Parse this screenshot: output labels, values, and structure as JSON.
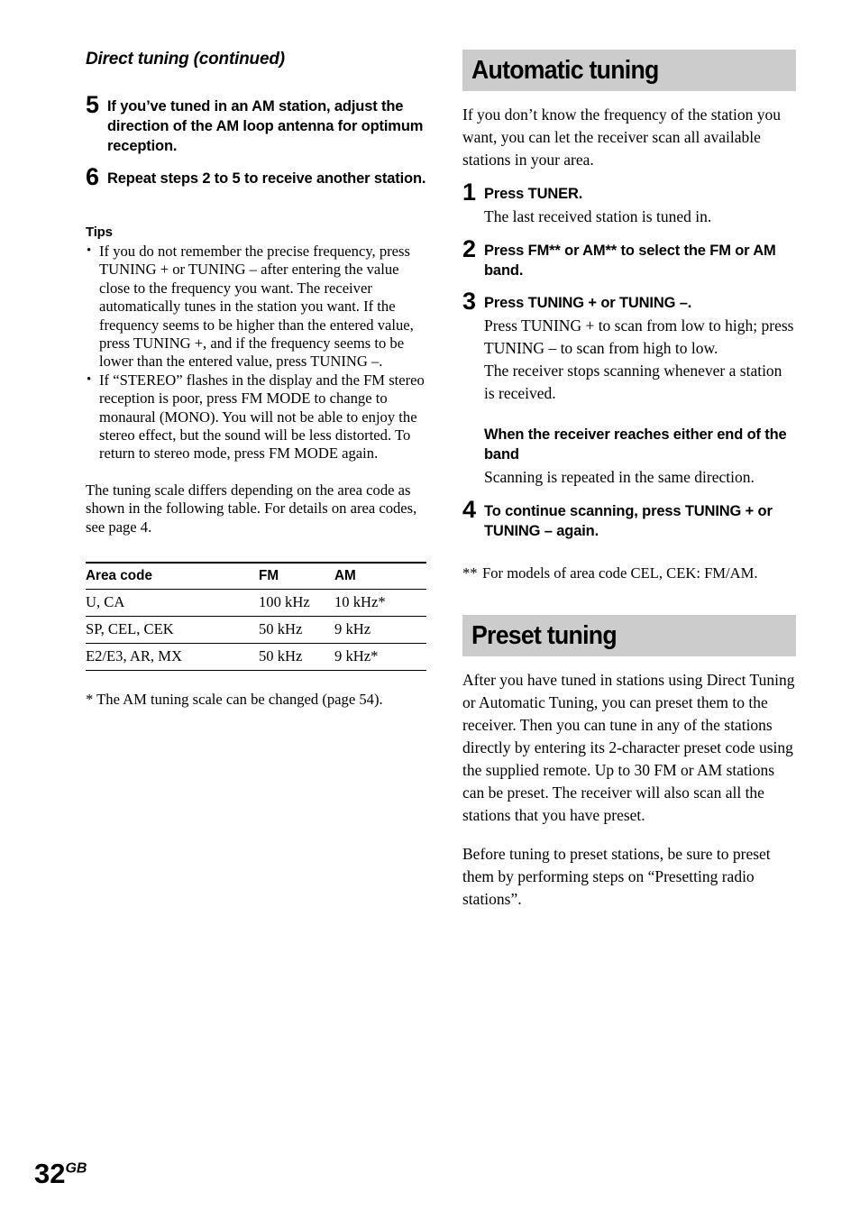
{
  "page": {
    "number": "32",
    "region_suffix": "GB"
  },
  "left_column": {
    "running_head": "Direct tuning (continued)",
    "steps": [
      {
        "number": "5",
        "title": "If you’ve tuned in an AM station, adjust the direction of the AM loop antenna for optimum reception."
      },
      {
        "number": "6",
        "title": "Repeat steps 2 to 5 to receive another station."
      }
    ],
    "tips_heading": "Tips",
    "tips": [
      "If you do not remember the precise frequency, press TUNING + or TUNING – after entering the value close to the frequency you want. The receiver automatically tunes in the station you want. If the frequency seems to be higher than the entered value, press TUNING +, and if the frequency seems to be lower than the entered value, press TUNING –.",
      "If “STEREO” flashes in the display and the FM stereo reception is poor, press FM MODE to change to monaural (MONO). You will not be able to enjoy the stereo effect, but the sound will be less distorted. To return to stereo mode, press FM MODE again."
    ],
    "table_intro": "The tuning scale differs depending on the area code as shown in the following table. For details on area codes, see page 4.",
    "table": {
      "headers": [
        "Area code",
        "FM",
        "AM"
      ],
      "rows": [
        [
          "U, CA",
          "100 kHz",
          "10 kHz*"
        ],
        [
          "SP, CEL, CEK",
          "50 kHz",
          "9 kHz"
        ],
        [
          "E2/E3, AR, MX",
          "50 kHz",
          "9 kHz*"
        ]
      ]
    },
    "table_note": "* The AM tuning scale can be changed (page 54)."
  },
  "right_column": {
    "section_automatic": {
      "title": "Automatic tuning",
      "intro": "If you don’t know the frequency of the station you want, you can let the receiver scan all available stations in your area.",
      "steps": [
        {
          "number": "1",
          "title": "Press TUNER.",
          "desc": "The last received station is tuned in."
        },
        {
          "number": "2",
          "title": "Press FM** or AM** to select the FM or AM band.",
          "desc": ""
        },
        {
          "number": "3",
          "title": "Press TUNING + or TUNING –.",
          "desc_1": "Press TUNING + to scan from low to high; press TUNING – to scan from high to low.",
          "desc_2": "The receiver stops scanning whenever a station is received."
        },
        {
          "number": "4",
          "title": "To continue scanning, press TUNING + or TUNING – again."
        }
      ],
      "subhead": "When the receiver reaches either end of the band",
      "subhead_desc": "Scanning is repeated in the same direction.",
      "footnote_mark": "**",
      "footnote_text": "For models of area code CEL, CEK: FM/AM."
    },
    "section_preset": {
      "title": "Preset tuning",
      "paragraph_1": "After you have tuned in stations using Direct Tuning or Automatic Tuning, you can preset them to the receiver. Then you can tune in any of the stations directly by entering its 2-character preset code using the supplied remote. Up to 30 FM or AM stations can be preset. The receiver will also scan all the stations that you have preset.",
      "paragraph_2": "Before tuning to preset stations, be sure to preset them by performing steps on “Presetting radio stations”."
    }
  },
  "colors": {
    "section_bar_background": "#cccccc",
    "text": "#000000",
    "page_background": "#ffffff"
  }
}
